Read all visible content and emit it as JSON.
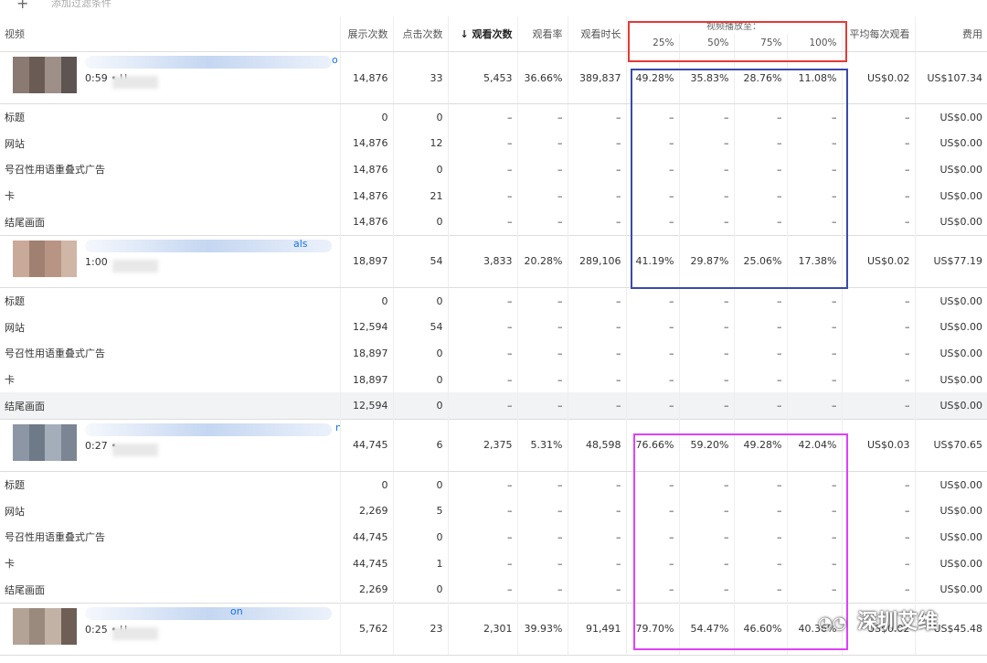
{
  "toolbar": {
    "add_filter_icon": "+",
    "add_filter_label": "添加过滤条件"
  },
  "columns": {
    "video": "视频",
    "impressions": "展示次数",
    "clicks": "点击次数",
    "views": "↓ 观看次数",
    "view_rate": "观看率",
    "watch_time": "观看时长",
    "video_played_group": "视频播放至：",
    "p25": "25%",
    "p50": "50%",
    "p75": "75%",
    "p100": "100%",
    "avg_cpv": "平均每次观看",
    "cost": "费用"
  },
  "videos": [
    {
      "title_tail": "o",
      "duration": "0:59 • U",
      "thumb_colors": [
        "#8a7a72",
        "#6b5b55",
        "#9e8f88",
        "#5e5452"
      ],
      "metrics": [
        "14,876",
        "33",
        "5,453",
        "36.66%",
        "389,837",
        "49.28%",
        "35.83%",
        "28.76%",
        "11.08%",
        "US$0.02",
        "US$107.34"
      ],
      "sub_rows": [
        {
          "label": "标题",
          "values": [
            "0",
            "0",
            "–",
            "–",
            "–",
            "–",
            "–",
            "–",
            "–",
            "–",
            "US$0.00"
          ]
        },
        {
          "label": "网站",
          "values": [
            "14,876",
            "12",
            "–",
            "–",
            "–",
            "–",
            "–",
            "–",
            "–",
            "–",
            "US$0.00"
          ]
        },
        {
          "label": "号召性用语重叠式广告",
          "values": [
            "14,876",
            "0",
            "–",
            "–",
            "–",
            "–",
            "–",
            "–",
            "–",
            "–",
            "US$0.00"
          ]
        },
        {
          "label": "卡",
          "values": [
            "14,876",
            "21",
            "–",
            "–",
            "–",
            "–",
            "–",
            "–",
            "–",
            "–",
            "US$0.00"
          ]
        },
        {
          "label": "结尾画面",
          "values": [
            "14,876",
            "0",
            "–",
            "–",
            "–",
            "–",
            "–",
            "–",
            "–",
            "–",
            "US$0.00"
          ]
        }
      ]
    },
    {
      "title_tail": "als",
      "duration": "1:00",
      "thumb_colors": [
        "#c9a99a",
        "#a08070",
        "#b89484",
        "#d0b6a6"
      ],
      "metrics": [
        "18,897",
        "54",
        "3,833",
        "20.28%",
        "289,106",
        "41.19%",
        "29.87%",
        "25.06%",
        "17.38%",
        "US$0.02",
        "US$77.19"
      ],
      "sub_rows": [
        {
          "label": "标题",
          "values": [
            "0",
            "0",
            "–",
            "–",
            "–",
            "–",
            "–",
            "–",
            "–",
            "–",
            "US$0.00"
          ]
        },
        {
          "label": "网站",
          "values": [
            "12,594",
            "54",
            "–",
            "–",
            "–",
            "–",
            "–",
            "–",
            "–",
            "–",
            "US$0.00"
          ]
        },
        {
          "label": "号召性用语重叠式广告",
          "values": [
            "18,897",
            "0",
            "–",
            "–",
            "–",
            "–",
            "–",
            "–",
            "–",
            "–",
            "US$0.00"
          ]
        },
        {
          "label": "卡",
          "values": [
            "18,897",
            "0",
            "–",
            "–",
            "–",
            "–",
            "–",
            "–",
            "–",
            "–",
            "US$0.00"
          ]
        },
        {
          "label": "结尾画面",
          "values": [
            "12,594",
            "0",
            "–",
            "–",
            "–",
            "–",
            "–",
            "–",
            "–",
            "–",
            "US$0.00"
          ],
          "highlight": true
        }
      ]
    },
    {
      "title_tail": "n",
      "duration": "0:27 •",
      "thumb_colors": [
        "#8d96a4",
        "#6f7a88",
        "#a4adba",
        "#7b8594"
      ],
      "metrics": [
        "44,745",
        "6",
        "2,375",
        "5.31%",
        "48,598",
        "76.66%",
        "59.20%",
        "49.28%",
        "42.04%",
        "US$0.03",
        "US$70.65"
      ],
      "sub_rows": [
        {
          "label": "标题",
          "values": [
            "0",
            "0",
            "–",
            "–",
            "–",
            "–",
            "–",
            "–",
            "–",
            "–",
            "US$0.00"
          ]
        },
        {
          "label": "网站",
          "values": [
            "2,269",
            "5",
            "–",
            "–",
            "–",
            "–",
            "–",
            "–",
            "–",
            "–",
            "US$0.00"
          ]
        },
        {
          "label": "号召性用语重叠式广告",
          "values": [
            "44,745",
            "0",
            "–",
            "–",
            "–",
            "–",
            "–",
            "–",
            "–",
            "–",
            "US$0.00"
          ]
        },
        {
          "label": "卡",
          "values": [
            "44,745",
            "1",
            "–",
            "–",
            "–",
            "–",
            "–",
            "–",
            "–",
            "–",
            "US$0.00"
          ]
        },
        {
          "label": "结尾画面",
          "values": [
            "2,269",
            "0",
            "–",
            "–",
            "–",
            "–",
            "–",
            "–",
            "–",
            "–",
            "US$0.00"
          ]
        }
      ]
    },
    {
      "title_tail": "on",
      "duration": "0:25 • U",
      "thumb_colors": [
        "#b3a396",
        "#9a8a7e",
        "#c2b2a6",
        "#6e5e55"
      ],
      "metrics": [
        "5,762",
        "23",
        "2,301",
        "39.93%",
        "91,491",
        "79.70%",
        "54.47%",
        "46.60%",
        "40.36%",
        "US$0.02",
        "US$45.48"
      ],
      "sub_rows": []
    }
  ],
  "watermark": {
    "icon": "wechat-logo",
    "text": "深圳艾维"
  },
  "colors": {
    "red_box": "#e53935",
    "blue_box": "#3949ab",
    "pink_box": "#e040fb",
    "link": "#1a73e8"
  }
}
